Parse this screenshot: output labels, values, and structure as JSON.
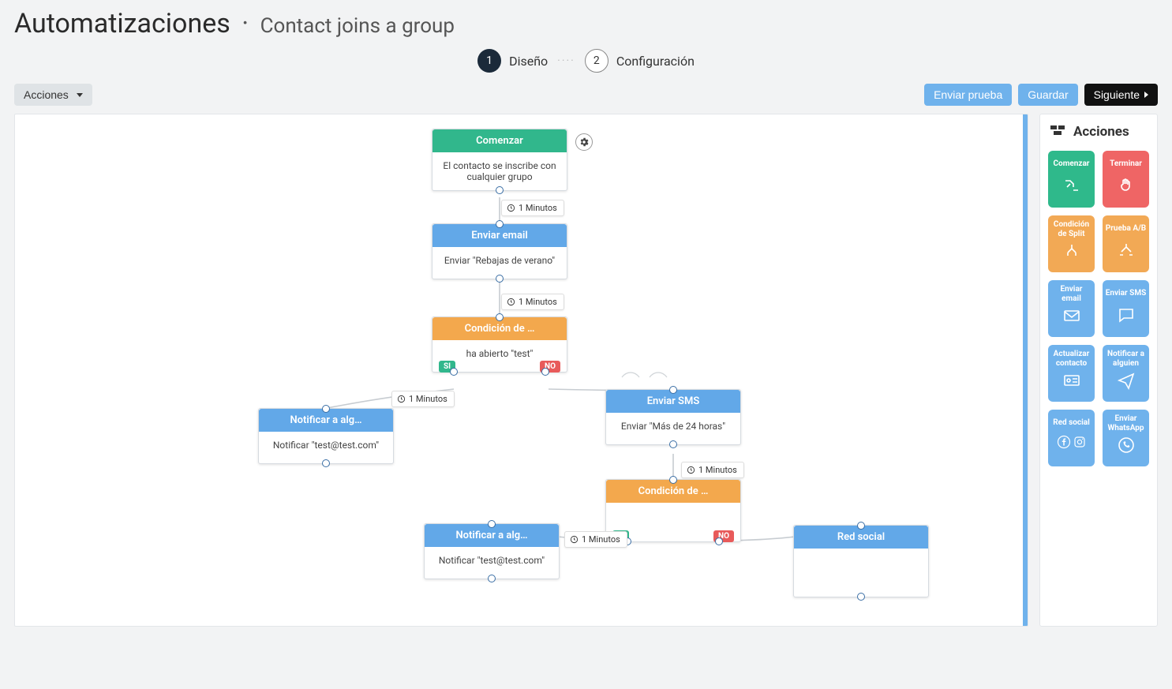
{
  "page": {
    "title": "Automatizaciones",
    "dot": "·",
    "subtitle": "Contact joins a group"
  },
  "stepper": {
    "step1_num": "1",
    "step1_label": "Diseño",
    "dots": "····",
    "step2_num": "2",
    "step2_label": "Configuración"
  },
  "toolbar": {
    "actions_label": "Acciones",
    "send_test": "Enviar prueba",
    "save": "Guardar",
    "next": "Siguiente"
  },
  "delays": {
    "d1": "1 Minutos",
    "d2": "1 Minutos",
    "d3": "1 Minutos",
    "d4": "1 Minutos",
    "d5": "1 Minutos"
  },
  "nodes": {
    "start": {
      "title": "Comenzar",
      "body": "El contacto se inscribe con cualquier grupo"
    },
    "email": {
      "title": "Enviar email",
      "body": "Enviar \"Rebajas de verano\""
    },
    "cond1": {
      "title": "Condición de …",
      "body": "ha abierto \"test\"",
      "si": "SI",
      "no": "NO"
    },
    "notify1": {
      "title": "Notificar a alg…",
      "body": "Notificar \"test@test.com\""
    },
    "sms": {
      "title": "Enviar SMS",
      "body": "Enviar \"Más de 24 horas\""
    },
    "cond2": {
      "title": "Condición de …",
      "body": "",
      "si": "SI",
      "no": "NO"
    },
    "notify2": {
      "title": "Notificar a alg…",
      "body": "Notificar \"test@test.com\""
    },
    "social": {
      "title": "Red social",
      "body": ""
    }
  },
  "palette": {
    "title": "Acciones",
    "items": {
      "start": "Comenzar",
      "end": "Terminar",
      "cond": "Condición de Split",
      "ab": "Prueba A/B",
      "email": "Enviar email",
      "sms": "Enviar SMS",
      "update": "Actualizar contacto",
      "notify": "Notificar a alguien",
      "social": "Red social",
      "whatsapp": "Enviar WhatsApp"
    }
  }
}
